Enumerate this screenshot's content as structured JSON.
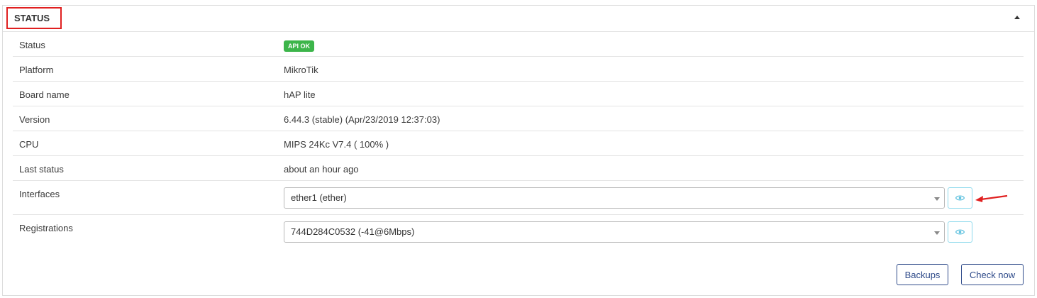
{
  "panel": {
    "title": "STATUS"
  },
  "rows": {
    "status": {
      "label": "Status",
      "badge": "API OK",
      "badge_color": "#3cb54a"
    },
    "platform": {
      "label": "Platform",
      "value": "MikroTik"
    },
    "board": {
      "label": "Board name",
      "value": "hAP lite"
    },
    "version": {
      "label": "Version",
      "value": "6.44.3 (stable) (Apr/23/2019 12:37:03)"
    },
    "cpu": {
      "label": "CPU",
      "value": "MIPS 24Kc V7.4 ( 100% )"
    },
    "last_status": {
      "label": "Last status",
      "value": "about an hour ago"
    },
    "interfaces": {
      "label": "Interfaces",
      "selected": "ether1 (ether)"
    },
    "registrations": {
      "label": "Registrations",
      "selected": "744D284C0532 (-41@6Mbps)"
    }
  },
  "actions": {
    "backups": "Backups",
    "check_now": "Check now"
  },
  "colors": {
    "title_highlight": "#e02020",
    "button": "#2f4b8a",
    "eye_button_border": "#8dd9ec",
    "annotation_arrow": "#e02020"
  },
  "icons": {
    "collapse": "caret-up-icon",
    "view": "eye-icon",
    "annotation": "red-arrow-icon"
  }
}
